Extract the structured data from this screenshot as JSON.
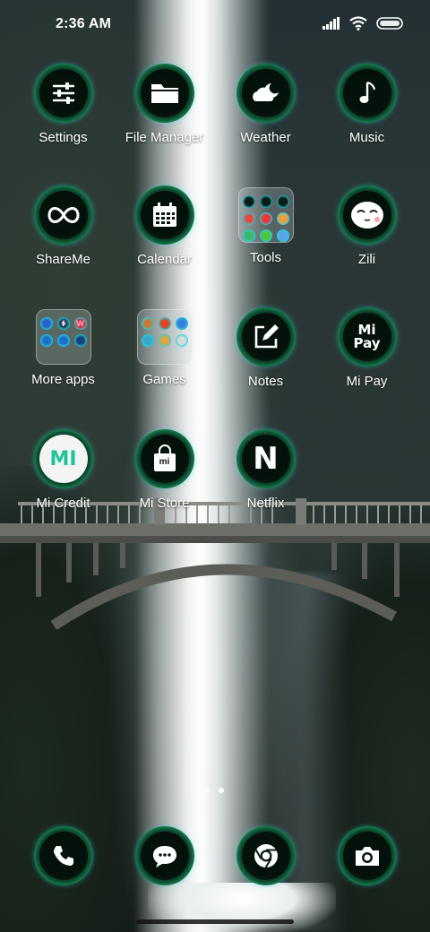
{
  "status_bar": {
    "time": "2:36 AM"
  },
  "apps": [
    {
      "label": "Settings",
      "icon": "sliders-icon"
    },
    {
      "label": "File Manager",
      "icon": "folder-icon"
    },
    {
      "label": "Weather",
      "icon": "cloud-moon-icon"
    },
    {
      "label": "Music",
      "icon": "music-note-icon"
    },
    {
      "label": "ShareMe",
      "icon": "infinity-icon"
    },
    {
      "label": "Calendar",
      "icon": "calendar-icon"
    },
    {
      "label": "Tools",
      "icon": "folder-preview"
    },
    {
      "label": "Zili",
      "icon": "face-icon"
    },
    {
      "label": "More apps",
      "icon": "folder-preview"
    },
    {
      "label": "Games",
      "icon": "folder-preview"
    },
    {
      "label": "Notes",
      "icon": "edit-note-icon"
    },
    {
      "label": "Mi Pay",
      "icon": "mi-pay-icon",
      "glyph": "Mi\nPay"
    },
    {
      "label": "Mi Credit",
      "icon": "mi-credit-icon",
      "glyph": "MI"
    },
    {
      "label": "Mi Store",
      "icon": "shopping-bag-icon",
      "glyph": "mi"
    },
    {
      "label": "Netflix",
      "icon": "netflix-icon",
      "glyph": "N"
    }
  ],
  "folder_previews": {
    "more_apps_letters": [
      "f",
      "W"
    ]
  },
  "dock": [
    {
      "name": "phone-icon"
    },
    {
      "name": "messages-icon"
    },
    {
      "name": "chrome-icon"
    },
    {
      "name": "camera-icon"
    }
  ],
  "page_indicator": {
    "pages": 2,
    "current": 2
  },
  "colors": {
    "ring_accent": "#1fe2f5",
    "ring_green": "#157a47",
    "glyph": "#ffffff"
  }
}
